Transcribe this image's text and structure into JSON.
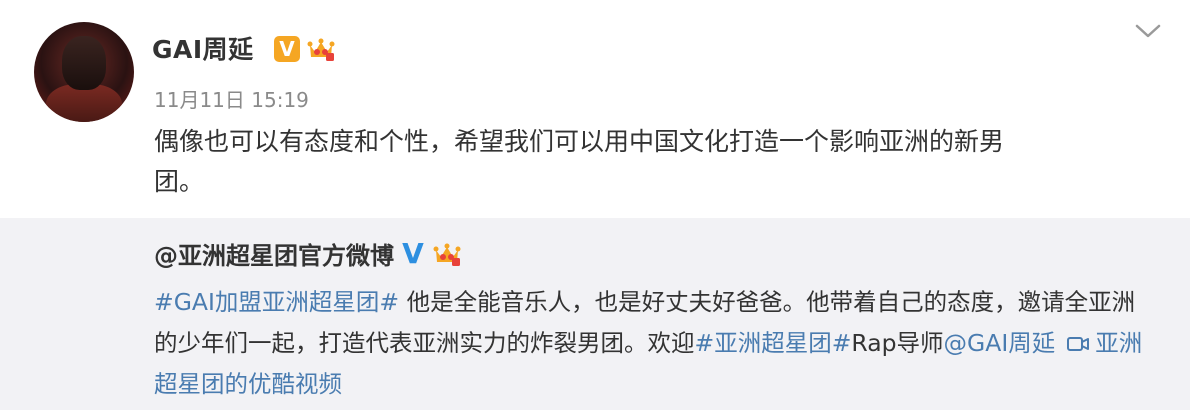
{
  "post": {
    "author": "GAI周延",
    "time": "11月11日 15:19",
    "text_line1": "偶像也可以有态度和个性，希望我们可以用中国文化打造一个影响亚洲的新男",
    "text_line2": "团。",
    "badge_letter": "V"
  },
  "repost": {
    "author": "@亚洲超星团官方微博",
    "badge_letter": "V",
    "hashtag1": "#GAI加盟亚洲超星团#",
    "text1": " 他是全能音乐人，也是好丈夫好爸爸。他带着自己的态度，邀请全亚洲",
    "text2": "的少年们一起，打造代表亚洲实力的炸裂男团。欢迎",
    "hashtag2": "#亚洲超星团#",
    "text3": "Rap导师",
    "mention": "@GAI周延",
    "video_link_a": "亚洲",
    "video_link_b": "超星团的优酷视频"
  },
  "icons": {
    "more": "chevron-down-icon",
    "video": "video-camera-icon",
    "vip": "crown-icon"
  },
  "colors": {
    "link": "#4a7cb0",
    "badge_orange": "#f5a623",
    "badge_blue": "#2d8fe0",
    "repost_bg": "#f2f2f5"
  }
}
